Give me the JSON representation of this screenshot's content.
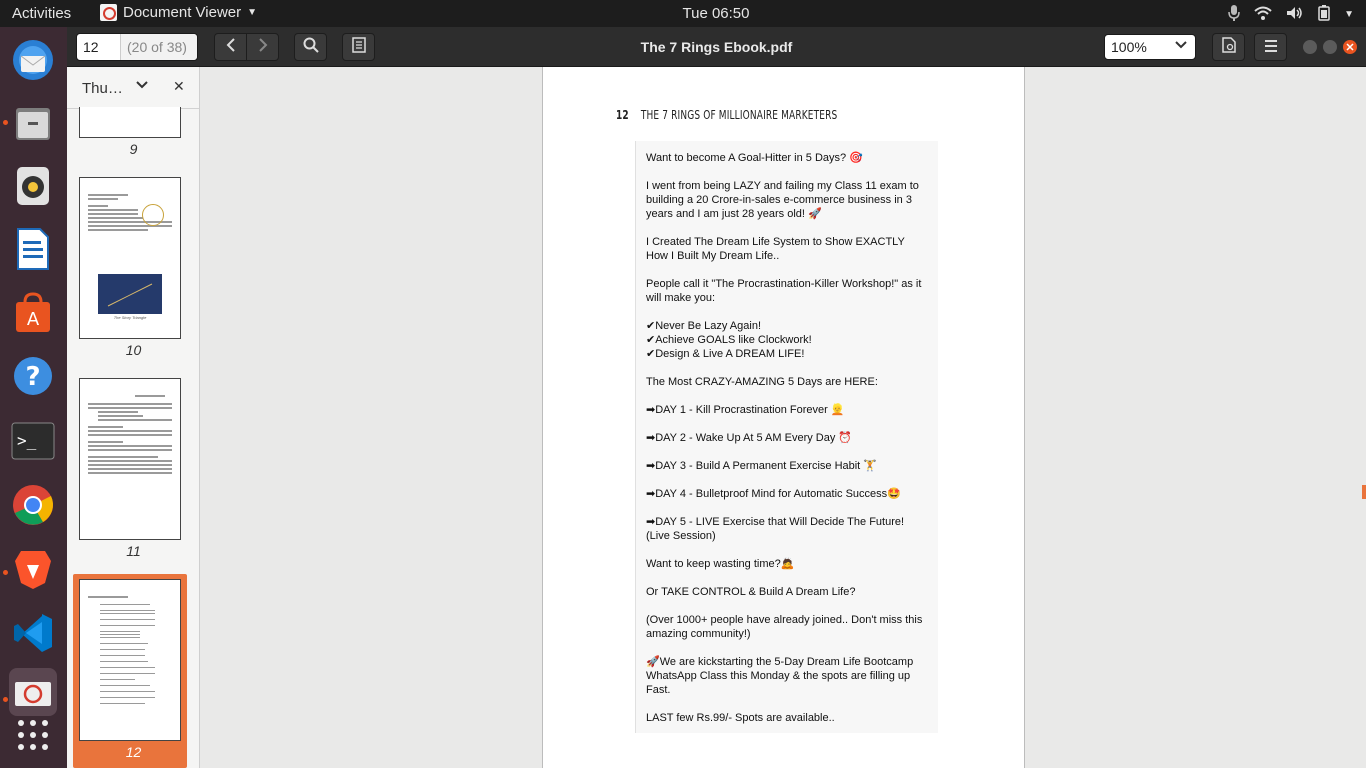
{
  "topbar": {
    "activities": "Activities",
    "app_name": "Document Viewer",
    "clock": "Tue 06:50"
  },
  "dock": {
    "items": [
      "thunderbird-icon",
      "files-icon",
      "rhythmbox-icon",
      "libreoffice-writer-icon",
      "ubuntu-software-icon",
      "help-icon",
      "terminal-icon",
      "chrome-icon",
      "brave-icon",
      "vscode-icon",
      "document-viewer-icon",
      "show-apps-icon"
    ]
  },
  "header": {
    "page_number": "12",
    "page_of": "(20 of 38)",
    "doc_title": "The 7 Rings Ebook.pdf",
    "zoom": "100%"
  },
  "sidebar": {
    "mode_label": "Thu…",
    "thumbs": [
      {
        "label": "9"
      },
      {
        "label": "10"
      },
      {
        "label": "11"
      },
      {
        "label": "12"
      }
    ],
    "page10_caption": "The Story Triangle"
  },
  "page": {
    "number": "12",
    "running_title": "THE 7 RINGS OF MILLIONAIRE MARKETERS",
    "lines": [
      "Want to become A Goal-Hitter in 5 Days? 🎯",
      "I went from being LAZY and failing my Class 11 exam to building a 20 Crore-in-sales e-commerce business in 3 years and I am just 28 years old! 🚀",
      "I Created The Dream Life System to Show EXACTLY How I Built My Dream Life..",
      "People call it \"The Procrastination-Killer Workshop!\" as it will make you:",
      "✔Never Be Lazy Again!",
      "✔Achieve GOALS like Clockwork!",
      "✔Design & Live A DREAM LIFE!",
      "The Most CRAZY-AMAZING 5 Days are HERE:",
      "➡DAY 1 - Kill Procrastination Forever 👱",
      "➡DAY 2 - Wake Up At 5 AM Every Day ⏰",
      "➡DAY 3 - Build A Permanent Exercise Habit 🏋",
      "➡DAY 4 - Bulletproof Mind for Automatic Success🤩",
      "➡DAY 5 - LIVE Exercise that Will Decide The Future! (Live Session)",
      "Want to keep wasting time?🙇",
      "Or TAKE CONTROL & Build A Dream Life?",
      "(Over 1000+ people have already joined.. Don't miss this amazing community!)",
      "🚀We are kickstarting the 5-Day Dream Life Bootcamp WhatsApp Class this Monday & the spots are filling up Fast.",
      "LAST few Rs.99/- Spots are available.."
    ]
  },
  "colors": {
    "accent": "#e9743c",
    "dock_bg": "#3c2a33",
    "headerbar": "#2d2d2d"
  }
}
